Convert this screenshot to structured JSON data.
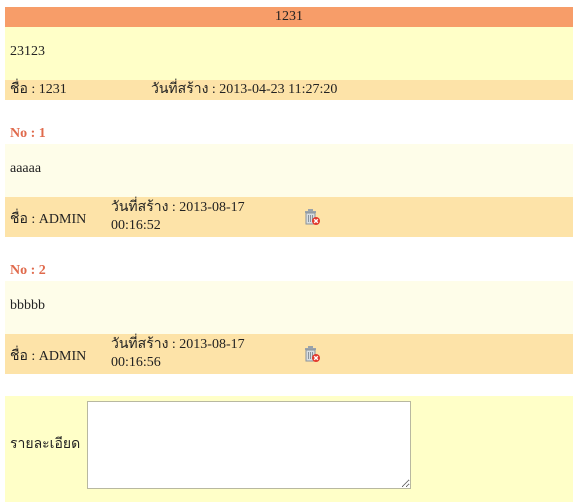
{
  "topic": {
    "title": "1231",
    "body": "23123",
    "author": "ชื่อ : 1231",
    "created": "วันที่สร้าง : 2013-04-23 11:27:20"
  },
  "replies": [
    {
      "no": "No : 1",
      "body": "aaaaa",
      "author": "ชื่อ : ADMIN",
      "created_label": "วันที่สร้าง : 2013-08-17",
      "created_time": "00:16:52",
      "delete_icon": "trash-delete-icon"
    },
    {
      "no": "No : 2",
      "body": "bbbbb",
      "author": "ชื่อ : ADMIN",
      "created_label": "วันที่สร้าง : 2013-08-17",
      "created_time": "00:16:56",
      "delete_icon": "trash-delete-icon"
    }
  ],
  "form": {
    "detail_label": "รายละเอียด",
    "detail_value": ""
  },
  "colors": {
    "header": "#f79d69",
    "body": "#ffffc8",
    "meta": "#fde3a8",
    "reply_body": "#fefde9",
    "no_label": "#e06a4c"
  }
}
